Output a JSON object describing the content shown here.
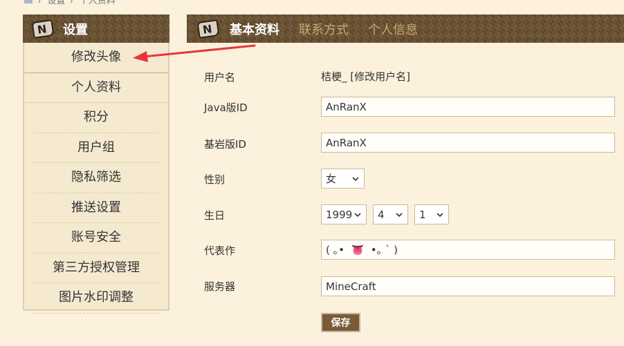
{
  "breadcrumb": {
    "items": [
      "设置",
      "个人资料"
    ],
    "separator": "/"
  },
  "sidebar": {
    "title": "设置",
    "items": [
      {
        "label": "修改头像"
      },
      {
        "label": "个人资料"
      },
      {
        "label": "积分"
      },
      {
        "label": "用户组"
      },
      {
        "label": "隐私筛选"
      },
      {
        "label": "推送设置"
      },
      {
        "label": "账号安全"
      },
      {
        "label": "第三方授权管理"
      },
      {
        "label": "图片水印调整"
      }
    ]
  },
  "tabs": [
    {
      "label": "基本资料",
      "active": true
    },
    {
      "label": "联系方式",
      "active": false
    },
    {
      "label": "个人信息",
      "active": false
    }
  ],
  "form": {
    "username_label": "用户名",
    "username_value": "桔梗_ [修改用户名]",
    "java_id_label": "Java版ID",
    "java_id_value": "AnRanX",
    "bedrock_id_label": "基岩版ID",
    "bedrock_id_value": "AnRanX",
    "gender_label": "性别",
    "gender_value": "女",
    "birthday_label": "生日",
    "birthday_year": "1999",
    "birthday_month": "4",
    "birthday_day": "1",
    "masterpiece_label": "代表作",
    "masterpiece_value": "( ｡•  👅  •｡ ` )",
    "server_label": "服务器",
    "server_value": "MineCraft",
    "save_label": "保存"
  },
  "colors": {
    "page_bg": "#fbf1dc",
    "header_brown": "#6a5232",
    "tab_inactive": "#c9a677",
    "annotation_arrow": "#e8343a",
    "save_button": "#7a5b38"
  }
}
